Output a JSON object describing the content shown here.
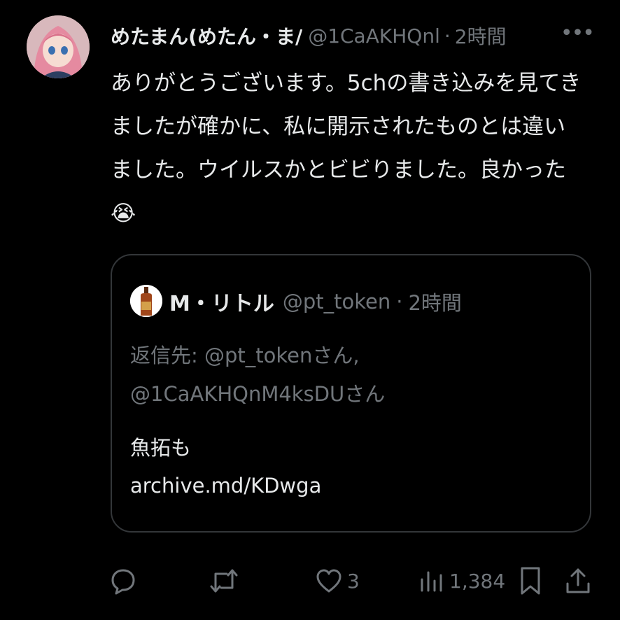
{
  "tweet": {
    "author_name": "めたまん(めたん・ま/",
    "author_handle": "@1CaAKHQnl",
    "separator": "·",
    "time": "2時間",
    "more_icon": "more-icon",
    "lines": [
      "ありがとうございます。5chの書き込みを見てき",
      "ましたが確かに、私に開示されたものとは違い",
      "ました。ウイルスかとビビりました。良かった",
      "😭"
    ]
  },
  "quote": {
    "author_name": "M・リトル",
    "author_handle": "@pt_token",
    "separator": "·",
    "time": "2時間",
    "reply_prefix": "返信先: ",
    "reply_line1_handle": "@pt_tokenさん,",
    "reply_line2_handle": "@1CaAKHQnM4ksDUさん",
    "text_line1": "魚拓も",
    "text_line2": "archive.md/KDwga"
  },
  "actions": {
    "reply_icon": "reply-icon",
    "retweet_icon": "retweet-icon",
    "like_icon": "heart-icon",
    "like_count": "3",
    "views_icon": "views-icon",
    "views_count": "1,384",
    "bookmark_icon": "bookmark-icon",
    "share_icon": "share-icon"
  },
  "colors": {
    "background": "#000000",
    "text": "#e7e9ea",
    "muted": "#71767b",
    "border": "#333639"
  }
}
